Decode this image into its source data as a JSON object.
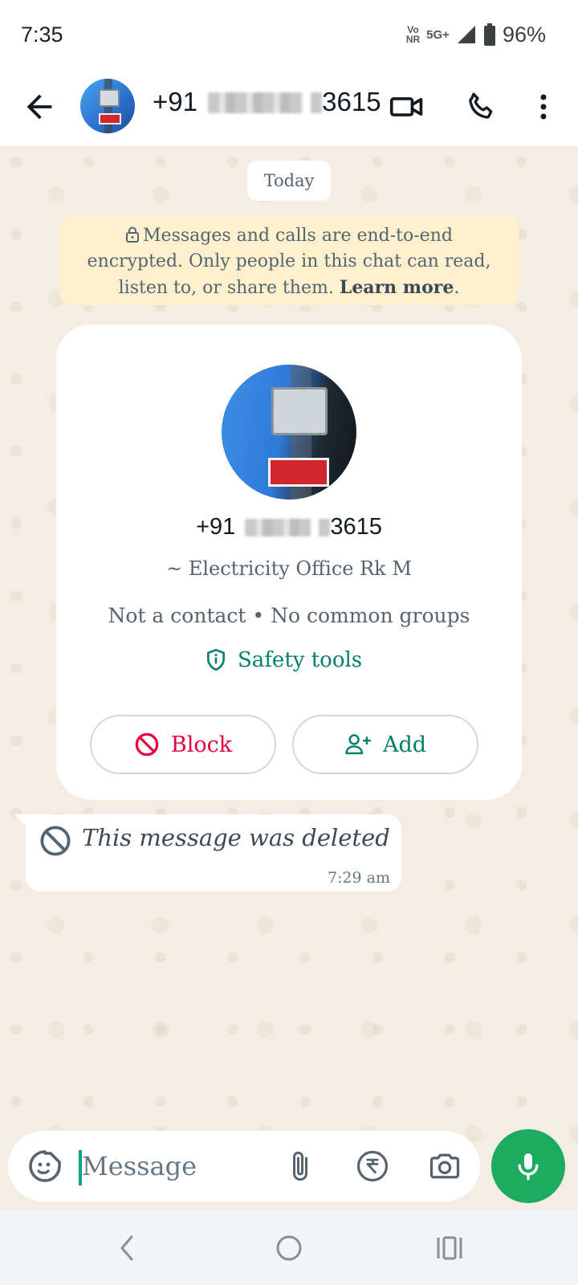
{
  "status_bar": {
    "time": "7:35",
    "volte_label_top": "Vo",
    "volte_label_bottom": "NR",
    "network": "5G+",
    "battery": "96%"
  },
  "header": {
    "phone_prefix": "+91",
    "phone_suffix": "3615"
  },
  "chat": {
    "date_label": "Today",
    "encryption_notice": "Messages and calls are end-to-end encrypted. Only people in this chat can read, listen to, or share them.",
    "learn_more": "Learn more",
    "learn_more_suffix": "."
  },
  "contact_card": {
    "phone_prefix": "+91",
    "phone_suffix": "3615",
    "name": "~ Electricity Office Rk M",
    "meta": "Not a contact • No common groups",
    "safety_tools": "Safety tools",
    "block_label": "Block",
    "add_label": "Add"
  },
  "message": {
    "text": "This message was deleted",
    "time": "7:29 am"
  },
  "composer": {
    "placeholder": "Message"
  },
  "colors": {
    "accent_green": "#008069",
    "mic_green": "#1daa61",
    "block_red": "#ea0038",
    "banner_yellow": "#fdf0cf",
    "wallpaper": "#f4ede3"
  },
  "icons": [
    "back-arrow-icon",
    "video-call-icon",
    "voice-call-icon",
    "more-vert-icon",
    "lock-icon",
    "shield-icon",
    "block-icon",
    "add-person-icon",
    "deleted-icon",
    "sticker-icon",
    "attach-icon",
    "rupee-icon",
    "camera-icon",
    "mic-icon"
  ]
}
